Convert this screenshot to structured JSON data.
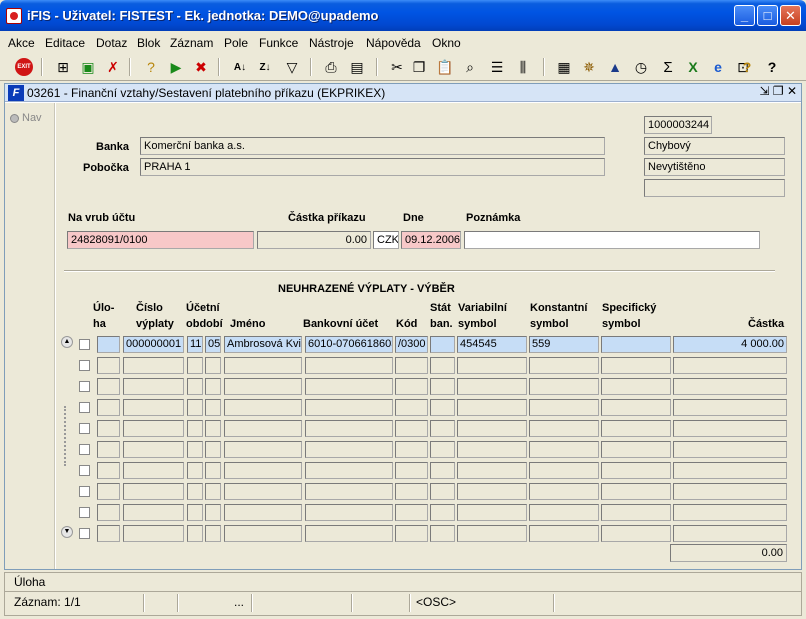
{
  "window": {
    "title": "iFIS - Uživatel: FISTEST - Ek. jednotka: DEMO@upademo"
  },
  "menu": [
    "Akce",
    "Editace",
    "Dotaz",
    "Blok",
    "Záznam",
    "Pole",
    "Funkce",
    "Nástroje",
    "Nápověda",
    "Okno"
  ],
  "toolbar": {
    "icons": [
      "exit-icon",
      "add-record-icon",
      "save-icon",
      "delete-record-icon",
      "query-icon",
      "run-query-icon",
      "cancel-query-icon",
      "sort-asc-icon",
      "sort-desc-icon",
      "filter-icon",
      "print-icon",
      "print-preview-icon",
      "cut-icon",
      "copy-icon",
      "paste-icon",
      "find-icon",
      "list-icon",
      "columns-icon",
      "calculator-icon",
      "wheel-icon",
      "shortcut-icon",
      "clock-icon",
      "sum-icon",
      "excel-icon",
      "ie-icon",
      "export-icon",
      "help-icon",
      "context-help-icon"
    ]
  },
  "form": {
    "title": "03261 - Finanční vztahy/Sestavení platebního příkazu (EKPRIKEX)",
    "nav_label": "Nav",
    "header": {
      "banka_label": "Banka",
      "banka_value": "Komerční banka a.s.",
      "pobocka_label": "Pobočka",
      "pobocka_value": "PRAHA 1",
      "id_value": "1000003244",
      "status1": "Chybový",
      "status2": "Nevytištěno",
      "status3": ""
    },
    "order": {
      "ucet_label": "Na vrub účtu",
      "ucet_value": "24828091/0100",
      "castka_label": "Částka příkazu",
      "castka_value": "0.00",
      "mena_value": "CZK",
      "dne_label": "Dne",
      "dne_value": "09.12.2006",
      "poznamka_label": "Poznámka",
      "poznamka_value": ""
    },
    "grid": {
      "title": "NEUHRAZENÉ VÝPLATY - VÝBĚR",
      "headers": {
        "uloha": "Úlo-\nha",
        "cislo": "Číslo\nvýplaty",
        "obdobi": "Účetní\nobdobí",
        "jmeno": "Jméno",
        "ucet": "Bankovní účet",
        "kod": "Kód",
        "stat": "Stát\nban.",
        "vs": "Variabilní\nsymbol",
        "ks": "Konstantní\nsymbol",
        "ss": "Specifický\nsymbol",
        "castka": "Částka"
      },
      "rows": [
        {
          "uloha": "",
          "cislo": "000000001",
          "obd1": "11",
          "obd2": "05",
          "jmeno": "Ambrosová Kvi",
          "ucet": "6010-0706618603",
          "kod": "/0300",
          "stat": "",
          "vs": "454545",
          "ks": "559",
          "ss": "",
          "castka": "4 000.00"
        },
        {},
        {},
        {},
        {},
        {},
        {},
        {},
        {},
        {}
      ],
      "total": "0.00"
    }
  },
  "statusbar": {
    "task": "Úloha",
    "record": "Záznam: 1/1",
    "ellipsis": "...",
    "mode": "<OSC>"
  }
}
